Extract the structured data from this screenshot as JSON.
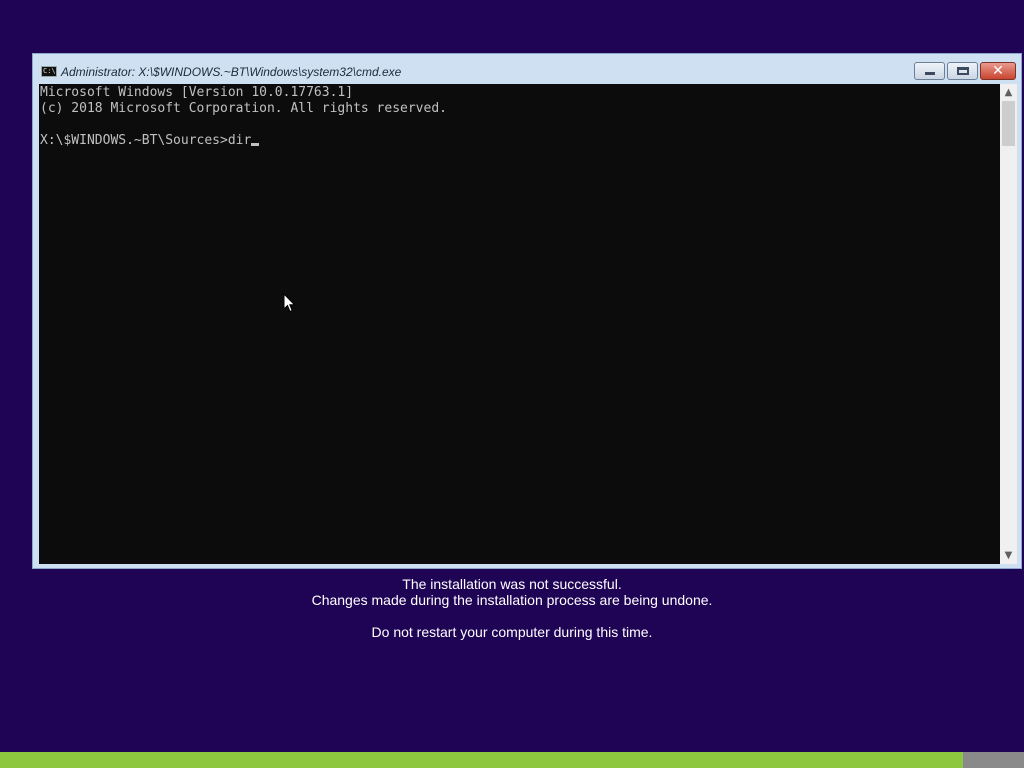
{
  "window": {
    "title": "Administrator: X:\\$WINDOWS.~BT\\Windows\\system32\\cmd.exe",
    "icon": "cmd-icon",
    "icon_text": "C:\\",
    "buttons": [
      "minimize-icon",
      "maximize-icon",
      "close-icon"
    ]
  },
  "console": {
    "lines": [
      "Microsoft Windows [Version 10.0.17763.1]",
      "(c) 2018 Microsoft Corporation. All rights reserved.",
      "",
      "X:\\$WINDOWS.~BT\\Sources>dir"
    ],
    "text_color": "#c0c0c0",
    "background_color": "#0c0c0c"
  },
  "status": {
    "line1": "The installation was not successful.",
    "line2": "Changes made during the installation process are being undone.",
    "line3": "Do not restart your computer during this time."
  },
  "progress": {
    "fraction": 0.94,
    "fill_color": "#8dc63f",
    "track_color": "#8a8a8a"
  },
  "colors": {
    "desktop_background": "#1f0456"
  }
}
